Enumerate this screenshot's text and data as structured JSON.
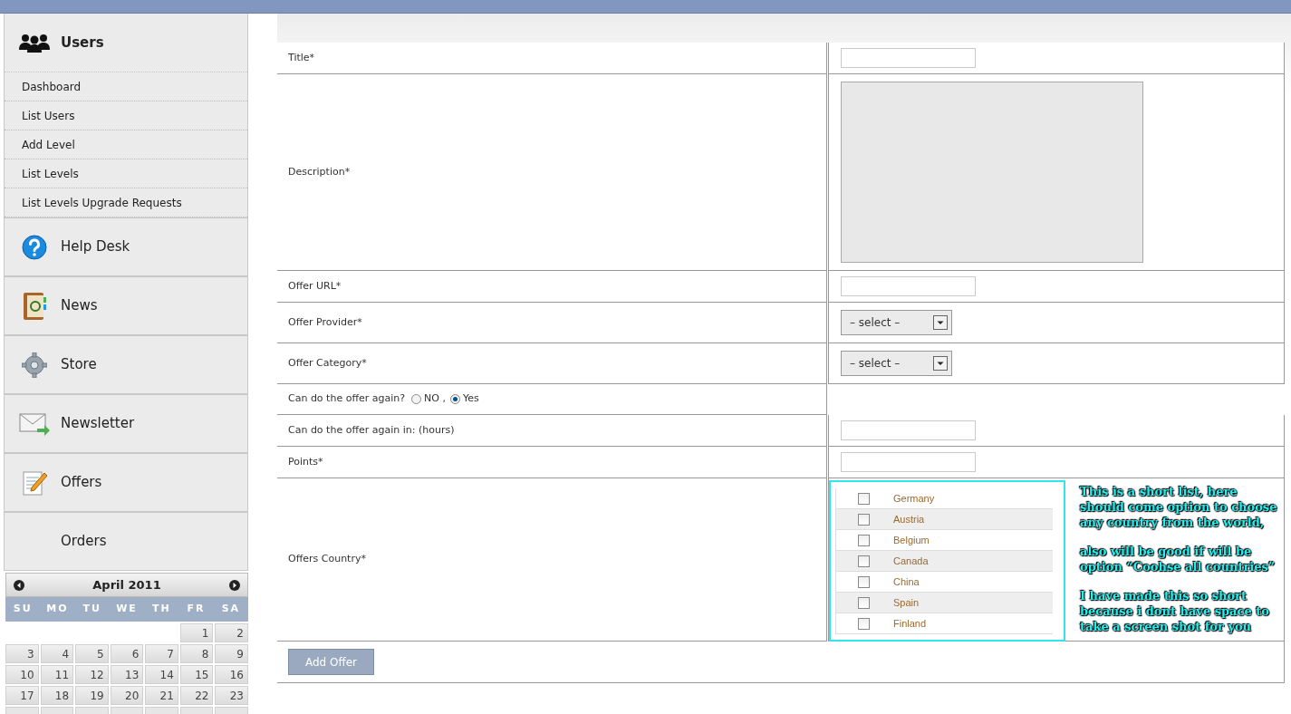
{
  "sidebar": {
    "sections": [
      {
        "label": "Users",
        "expanded": true,
        "items": [
          {
            "label": "Dashboard"
          },
          {
            "label": "List Users"
          },
          {
            "label": "Add Level"
          },
          {
            "label": "List Levels"
          },
          {
            "label": "List Levels Upgrade Requests"
          }
        ]
      },
      {
        "label": "Help Desk",
        "expanded": false
      },
      {
        "label": "News",
        "expanded": false
      },
      {
        "label": "Store",
        "expanded": false
      },
      {
        "label": "Newsletter",
        "expanded": false
      },
      {
        "label": "Offers",
        "expanded": false
      },
      {
        "label": "Orders",
        "expanded": false
      }
    ]
  },
  "calendar": {
    "title": "April 2011",
    "weekdays": [
      "SU",
      "MO",
      "TU",
      "WE",
      "TH",
      "FR",
      "SA"
    ],
    "weeks": [
      [
        "1",
        "2"
      ],
      [
        "3",
        "4",
        "5",
        "6",
        "7",
        "8",
        "9"
      ],
      [
        "10",
        "11",
        "12",
        "13",
        "14",
        "15",
        "16"
      ],
      [
        "17",
        "18",
        "19",
        "20",
        "21",
        "22",
        "23"
      ]
    ]
  },
  "form": {
    "rows": [
      {
        "kind": "text",
        "label": "Title*"
      },
      {
        "kind": "textarea",
        "label": "Description*"
      },
      {
        "kind": "text",
        "label": "Offer URL*"
      },
      {
        "kind": "select",
        "label": "Offer Provider*",
        "placeholder": "– select –"
      },
      {
        "kind": "select",
        "label": "Offer Category*",
        "placeholder": "– select –"
      },
      {
        "kind": "radio",
        "label": "Can do the offer again?",
        "options": [
          {
            "label": "NO ,",
            "selected": false
          },
          {
            "label": "Yes",
            "selected": true
          }
        ]
      },
      {
        "kind": "text",
        "label": "Can do the offer again in: (hours)"
      },
      {
        "kind": "text",
        "label": "Points*"
      },
      {
        "kind": "countries",
        "label": "Offers Country*",
        "countries": [
          {
            "label": "Germany",
            "checked": false
          },
          {
            "label": "Austria",
            "checked": false
          },
          {
            "label": "Belgium",
            "checked": false
          },
          {
            "label": "Canada",
            "checked": false
          },
          {
            "label": "China",
            "checked": false
          },
          {
            "label": "Spain",
            "checked": false
          },
          {
            "label": "Finland",
            "checked": false
          }
        ],
        "annotation": [
          "This is a short list, here should come option to choose any country from the world,",
          "also will be good if will be option “Coohse all countries”",
          "I have made this so short because i dont have space to take a screen shot for you"
        ]
      }
    ],
    "submit": "Add Offer"
  }
}
